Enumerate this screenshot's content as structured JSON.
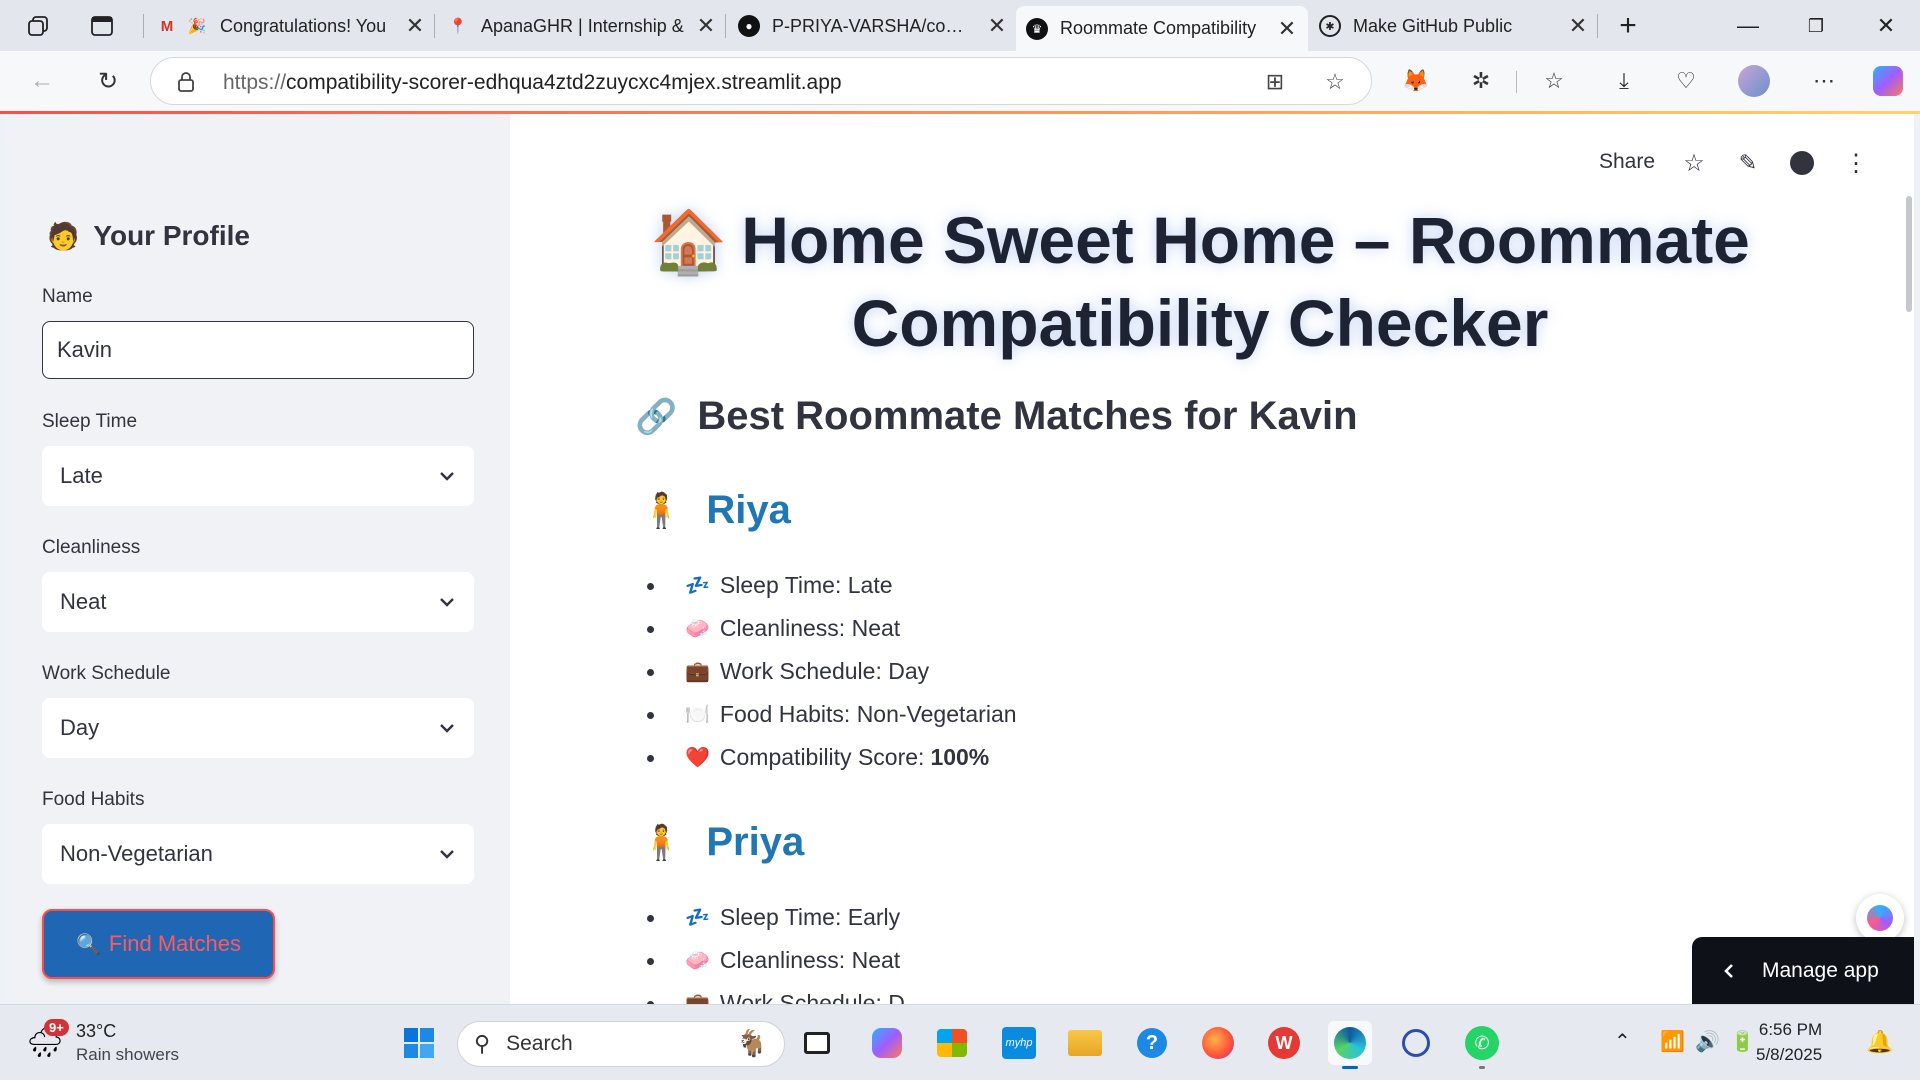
{
  "browser": {
    "tabs": [
      {
        "title": "Congratulations! You",
        "icon": "gmail-icon"
      },
      {
        "title": "ApanaGHR | Internship &",
        "icon": "location-pin-icon"
      },
      {
        "title": "P-PRIYA-VARSHA/compa",
        "icon": "github-icon"
      },
      {
        "title": "Roommate Compatibility",
        "icon": "streamlit-crown-icon",
        "active": true
      },
      {
        "title": "Make GitHub Public",
        "icon": "chatgpt-icon"
      }
    ],
    "url_scheme": "https://",
    "url_host": "compatibility-scorer-edhqua4ztd2zuycxc4mjex.streamlit.app",
    "accent_color": "#ff4b4b"
  },
  "sidebar": {
    "title": "Your Profile",
    "title_emoji": "🧑",
    "name_label": "Name",
    "name_value": "Kavin",
    "sleep_label": "Sleep Time",
    "sleep_value": "Late",
    "clean_label": "Cleanliness",
    "clean_value": "Neat",
    "work_label": "Work Schedule",
    "work_value": "Day",
    "food_label": "Food Habits",
    "food_value": "Non-Vegetarian",
    "button_label": "Find Matches",
    "button_emoji": "🔍"
  },
  "main": {
    "toolbar": {
      "share_label": "Share"
    },
    "title_emoji": "🏠",
    "title_line1": "Home Sweet Home – Roommate",
    "title_line2": "Compatibility Checker",
    "subheader_emoji": "🔗",
    "subheader": "Best Roommate Matches for Kavin",
    "matches": [
      {
        "name": "Riya",
        "emoji": "🧍",
        "items": [
          {
            "emoji": "💤",
            "text": "Sleep Time: Late"
          },
          {
            "emoji": "🧼",
            "text": "Cleanliness: Neat"
          },
          {
            "emoji": "💼",
            "text": "Work Schedule: Day"
          },
          {
            "emoji": "🍽️",
            "text": "Food Habits: Non-Vegetarian"
          },
          {
            "emoji": "❤️",
            "text": "Compatibility Score:",
            "bold": "100%"
          }
        ]
      },
      {
        "name": "Priya",
        "emoji": "🧍",
        "items": [
          {
            "emoji": "💤",
            "text": "Sleep Time: Early"
          },
          {
            "emoji": "🧼",
            "text": "Cleanliness: Neat"
          },
          {
            "emoji": "💼",
            "text": "Work Schedule: D"
          }
        ]
      }
    ],
    "manage_app_label": "Manage app"
  },
  "taskbar": {
    "weather_temp": "33°C",
    "weather_cond": "Rain showers",
    "weather_badge": "9+",
    "search_placeholder": "Search",
    "time": "6:56 PM",
    "date": "5/8/2025"
  }
}
